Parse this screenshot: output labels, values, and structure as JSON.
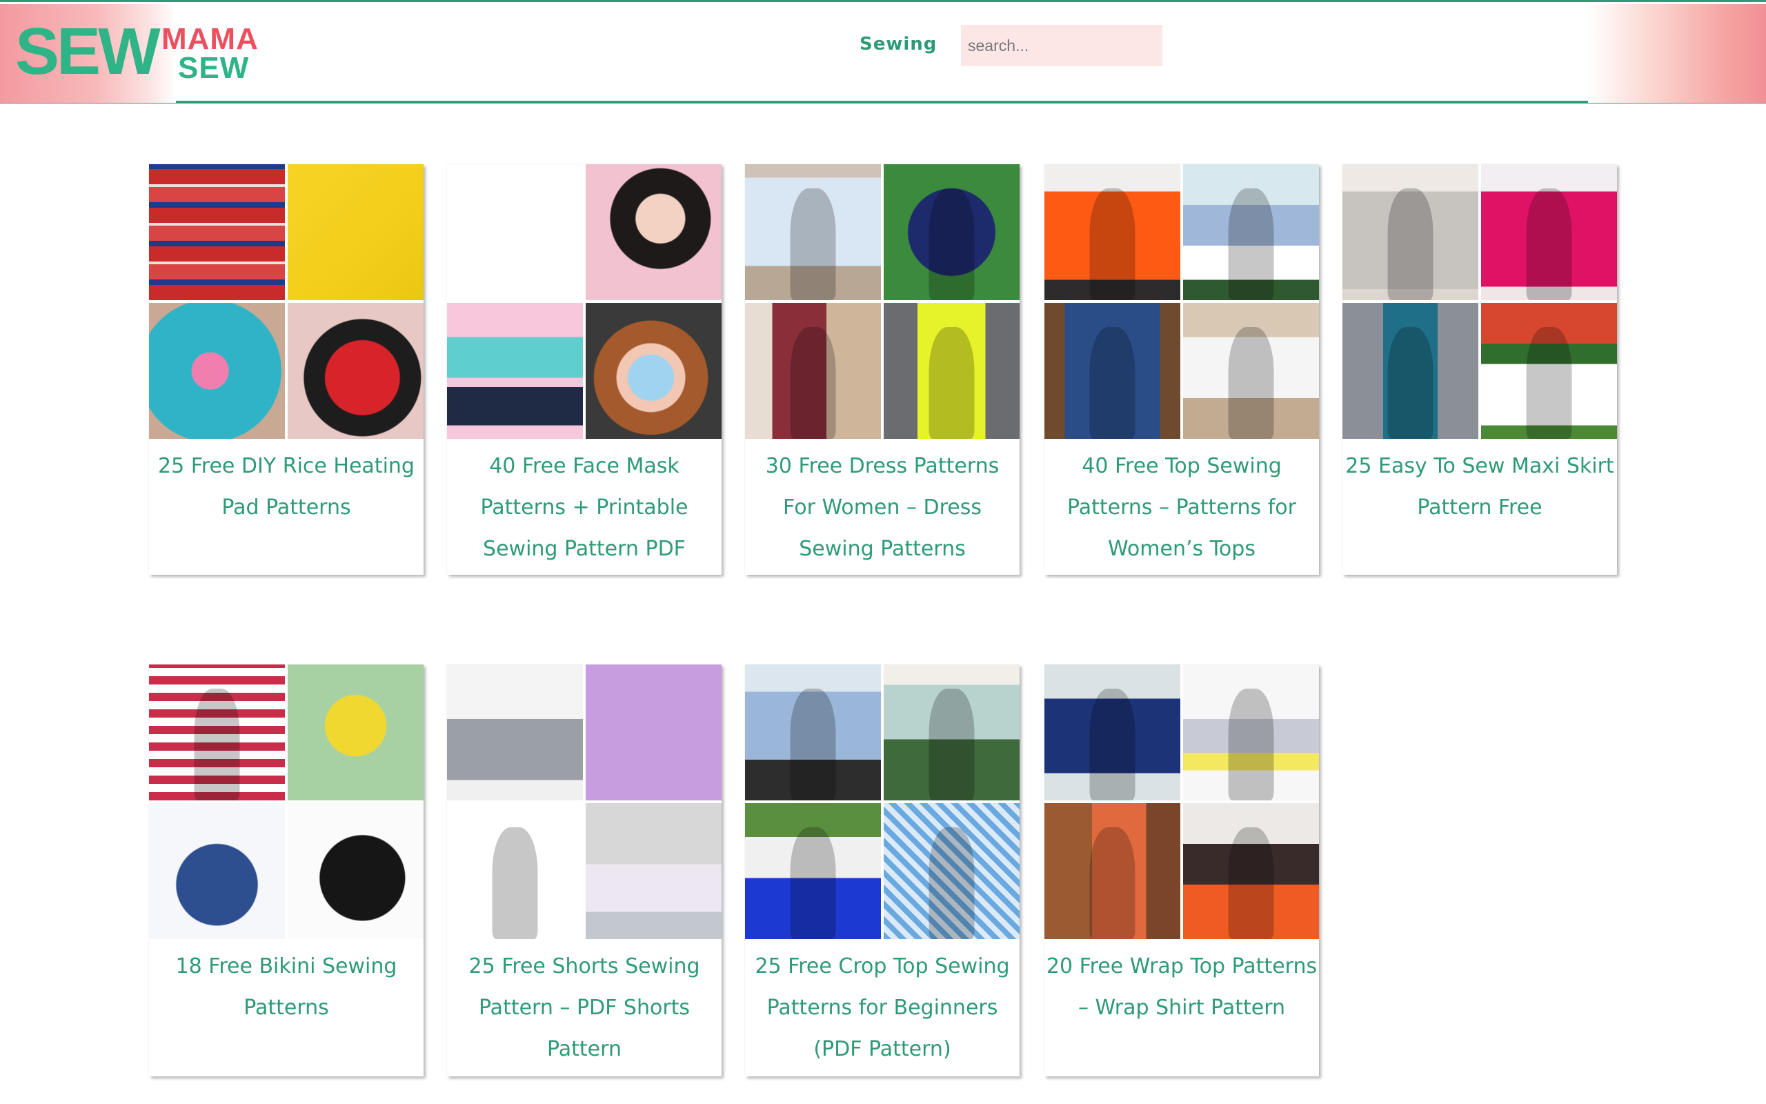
{
  "header": {
    "logo": {
      "word1": "SEW",
      "word2": "MAMA",
      "word3": "SEW"
    },
    "nav_link": "Sewing",
    "search_placeholder": "search..."
  },
  "colors": {
    "brand_green": "#2e9a78",
    "brand_pink": "#ee4f5e",
    "search_bg": "#fde6e6"
  },
  "cards": [
    {
      "title": "25 Free DIY Rice Heating Pad Patterns"
    },
    {
      "title": "40 Free Face Mask Patterns + Printable Sewing Pattern PDF"
    },
    {
      "title": "30 Free Dress Patterns For Women – Dress Sewing Patterns"
    },
    {
      "title": "40 Free Top Sewing Patterns – Patterns for Women’s Tops"
    },
    {
      "title": "25 Easy To Sew Maxi Skirt Pattern Free"
    },
    {
      "title": "18 Free Bikini Sewing Patterns"
    },
    {
      "title": "25 Free Shorts Sewing Pattern – PDF Shorts Pattern"
    },
    {
      "title": "25 Free Crop Top Sewing Patterns for Beginners (PDF Pattern)"
    },
    {
      "title": "20 Free Wrap Top Patterns – Wrap Shirt Pattern"
    }
  ]
}
